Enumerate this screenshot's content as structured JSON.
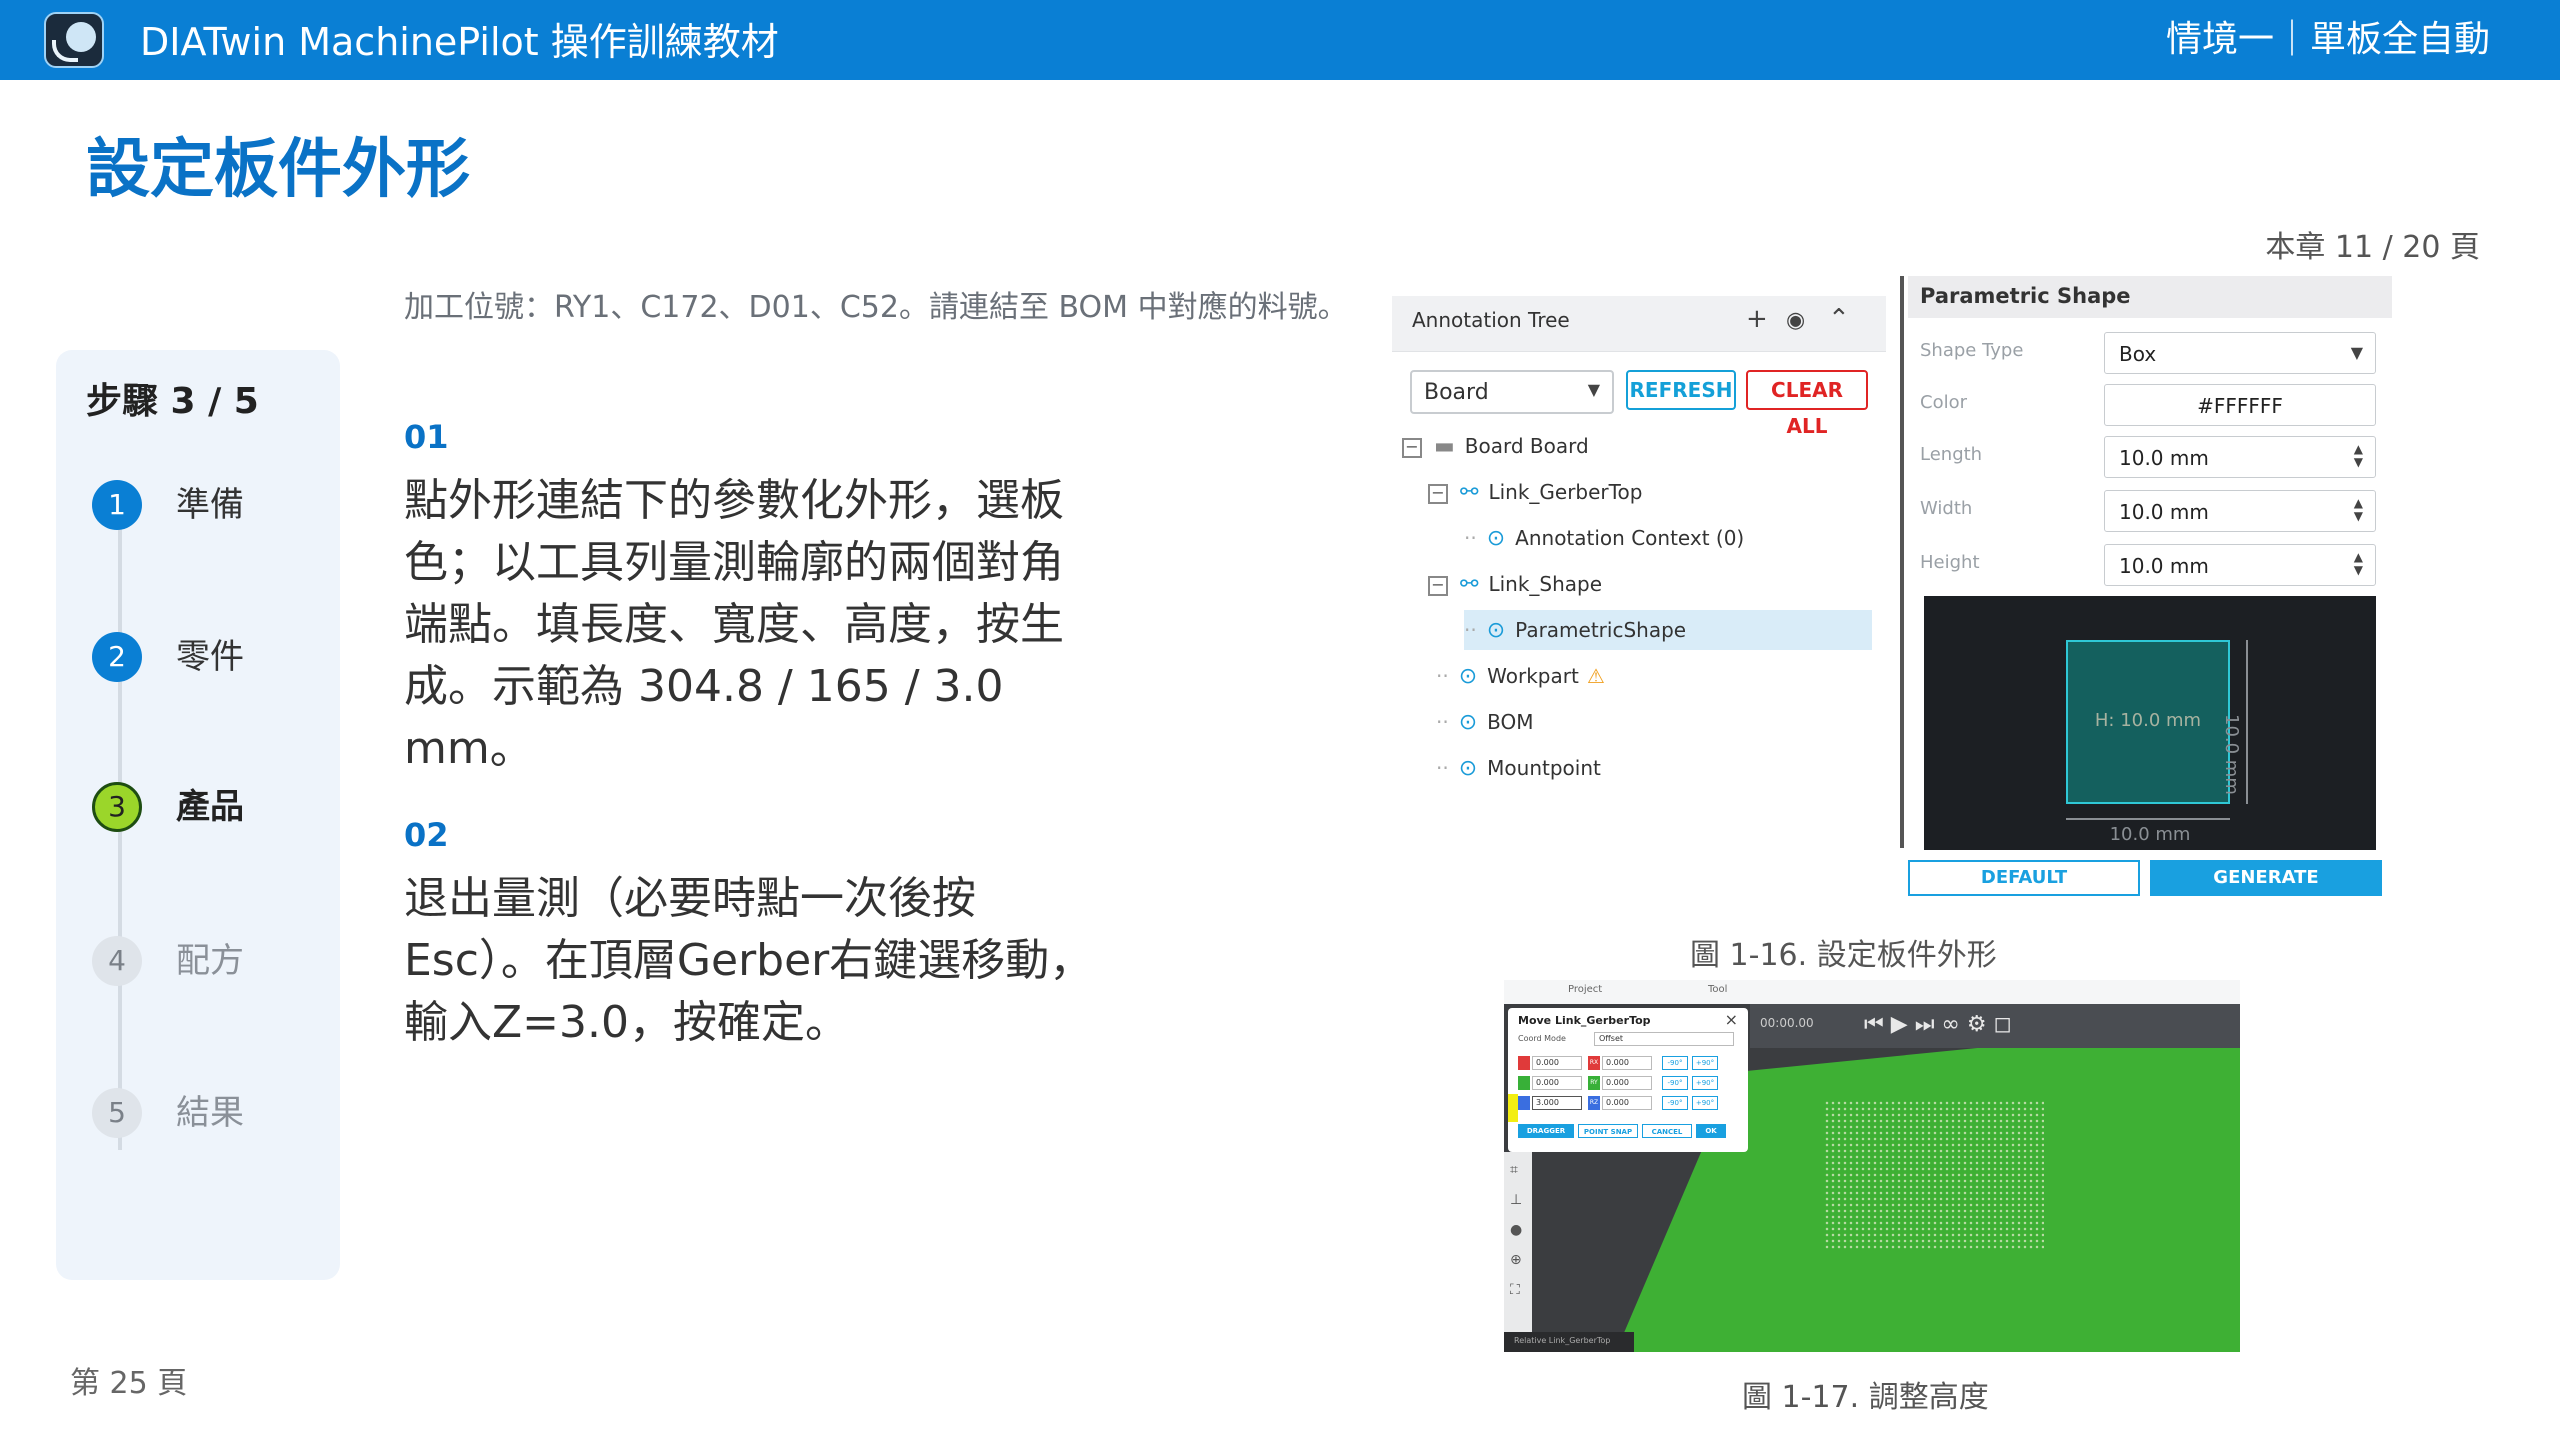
{
  "header": {
    "app_title": "DIATwin MachinePilot 操作訓練教材",
    "scene": "情境一｜單板全自動"
  },
  "page_title": "設定板件外形",
  "chapter_progress": "本章 11 / 20 頁",
  "intro": "加工位號：RY1、C172、D01、C52。請連結至 BOM 中對應的料號。",
  "steps": {
    "count_label": "步驟 3 / 5",
    "items": [
      {
        "num": "1",
        "label": "準備"
      },
      {
        "num": "2",
        "label": "零件"
      },
      {
        "num": "3",
        "label": "產品"
      },
      {
        "num": "4",
        "label": "配方"
      },
      {
        "num": "5",
        "label": "結果"
      }
    ]
  },
  "sections": [
    {
      "num": "01",
      "text": "點外形連結下的參數化外形，選板色；以工具列量測輪廓的兩個對角端點。填長度、寬度、高度，按生成。示範為 304.8 / 165 / 3.0 mm。"
    },
    {
      "num": "02",
      "text": "退出量測（必要時點一次後按Esc）。在頂層Gerber右鍵選移動，輸入Z=3.0，按確定。"
    }
  ],
  "page_number": "第 25 頁",
  "figure1": {
    "caption": "圖 1-16. 設定板件外形",
    "tree": {
      "title": "Annotation Tree",
      "icons": {
        "add": "+",
        "eye": "◉",
        "collapse": "⌃"
      },
      "selector": "Board",
      "refresh": "REFRESH",
      "clear_all": "CLEAR ALL",
      "nodes": [
        {
          "label": "Board  Board",
          "expander": "−",
          "icon": "folder-icon"
        },
        {
          "label": "Link_GerberTop",
          "expander": "−",
          "icon": "link-icon"
        },
        {
          "label": "Annotation Context (0)",
          "icon": "target-icon"
        },
        {
          "label": "Link_Shape",
          "expander": "−",
          "icon": "link-icon"
        },
        {
          "label": "ParametricShape",
          "icon": "target-icon"
        },
        {
          "label": "Workpart",
          "icon": "target-icon",
          "warning": "⚠"
        },
        {
          "label": "BOM",
          "icon": "target-icon"
        },
        {
          "label": "Mountpoint",
          "icon": "target-icon"
        }
      ]
    },
    "shape": {
      "title": "Parametric Shape",
      "rows": [
        {
          "key": "Shape Type",
          "value": "Box"
        },
        {
          "key": "Color",
          "value": "#FFFFFF"
        },
        {
          "key": "Length",
          "value": "10.0 mm"
        },
        {
          "key": "Width",
          "value": "10.0 mm"
        },
        {
          "key": "Height",
          "value": "10.0 mm"
        }
      ],
      "preview_center": "H: 10.0 mm",
      "preview_width": "10.0 mm",
      "preview_height": "10.0 mm",
      "default_btn": "DEFAULT",
      "generate_btn": "GENERATE"
    }
  },
  "figure2": {
    "caption": "圖 1-17. 調整高度",
    "tabs": [
      "Project",
      "Tool"
    ],
    "player_time": "00:00.00",
    "dialog": {
      "title": "Move Link_GerberTop",
      "coord_mode_label": "Coord Mode",
      "coord_mode_value": "Offset",
      "rows": [
        {
          "axis": "RX",
          "a": "0.000",
          "b": "0.000"
        },
        {
          "axis": "RY",
          "a": "0.000",
          "b": "0.000"
        },
        {
          "axis": "RZ",
          "a": "3.000",
          "b": "0.000"
        }
      ],
      "minus90": "-90°",
      "plus90": "+90°",
      "buttons": [
        "DRAGGER",
        "POINT SNAP",
        "CANCEL",
        "OK"
      ]
    },
    "status": "Relative Link_GerberTop"
  },
  "colors": {
    "header_blue": "#0a7fd4",
    "title_blue": "#0a72c6",
    "current_step": "#9bd62a",
    "pcb_green": "#3eb034"
  }
}
